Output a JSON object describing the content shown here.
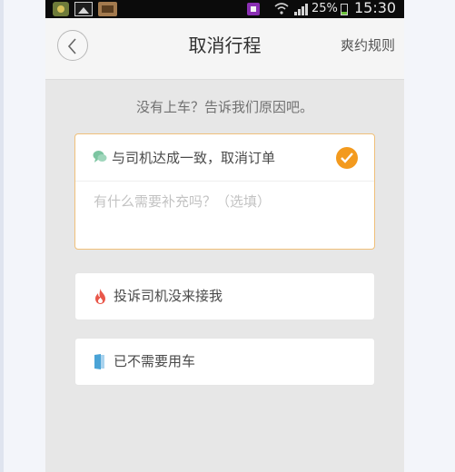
{
  "statusbar": {
    "battery_pct": "25%",
    "time": "15:30"
  },
  "header": {
    "title": "取消行程",
    "rules_link": "爽约规则"
  },
  "prompt": "没有上车？告诉我们原因吧。",
  "reasons": [
    {
      "label": "与司机达成一致，取消订单",
      "selected": true,
      "icon": "chat-icon",
      "note_placeholder": "有什么需要补充吗？（选填）"
    },
    {
      "label": "投诉司机没来接我",
      "selected": false,
      "icon": "flame-icon"
    },
    {
      "label": "已不需要用车",
      "selected": false,
      "icon": "door-icon"
    }
  ],
  "colors": {
    "accent": "#f39a1e",
    "chat_icon": "#7cc5a1",
    "flame_icon": "#e9574a",
    "door_icon": "#4aa3d6"
  }
}
